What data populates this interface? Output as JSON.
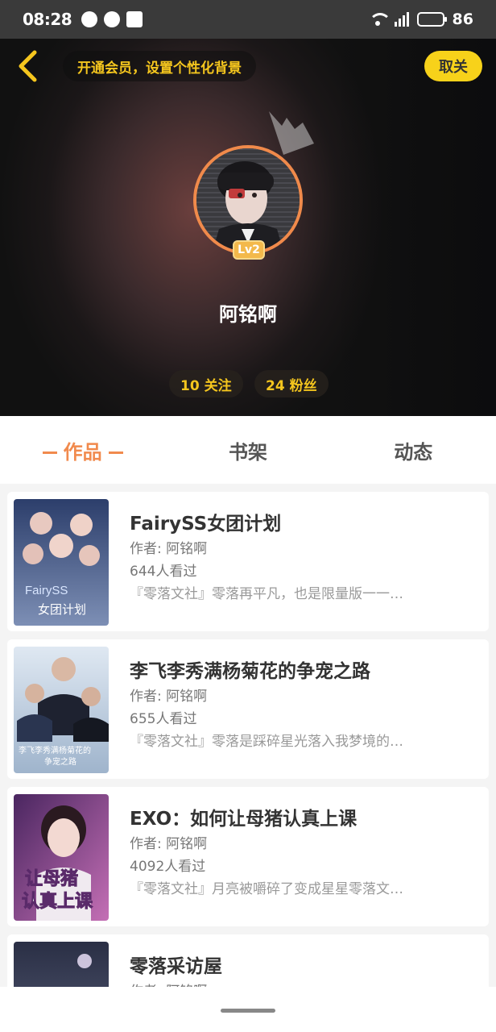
{
  "status_bar": {
    "time": "08:28",
    "battery": "86"
  },
  "header": {
    "vip_prompt": "开通会员，设置个性化背景",
    "cancel_label": "取关"
  },
  "profile": {
    "level": "Lv2",
    "name": "阿铭啊",
    "following": "10 关注",
    "followers": "24 粉丝"
  },
  "tabs": [
    {
      "label": "作品",
      "active": true
    },
    {
      "label": "书架",
      "active": false
    },
    {
      "label": "动态",
      "active": false
    }
  ],
  "works": [
    {
      "title": "FairySS女团计划",
      "author": "作者: 阿铭啊",
      "views": "644人看过",
      "desc": "『零落文社』零落再平凡，也是限量版一一…",
      "cover_text": [
        "FairySS",
        "女团计划"
      ],
      "cover_colors": [
        "#2c3e6b",
        "#7d8fb5"
      ]
    },
    {
      "title": "李飞李秀满杨菊花的争宠之路",
      "author": "作者: 阿铭啊",
      "views": "655人看过",
      "desc": "『零落文社』零落是踩碎星光落入我梦境的…",
      "cover_text": [
        "李飞李秀满杨菊花的",
        "争宠之路"
      ],
      "cover_colors": [
        "#dfe8f2",
        "#9fb4cc"
      ]
    },
    {
      "title": "EXO：如何让母猪认真上课",
      "author": "作者: 阿铭啊",
      "views": "4092人看过",
      "desc": "『零落文社』月亮被嚼碎了变成星星零落文…",
      "cover_text": [
        "让母猪",
        "认真上课"
      ],
      "cover_colors": [
        "#4a2660",
        "#c46fb5"
      ]
    },
    {
      "title": "零落采访屋",
      "author": "作者: 阿铭啊",
      "views": "",
      "desc": "",
      "cover_text": [
        "",
        ""
      ],
      "cover_colors": [
        "#2a2f45",
        "#5a607a"
      ]
    }
  ]
}
